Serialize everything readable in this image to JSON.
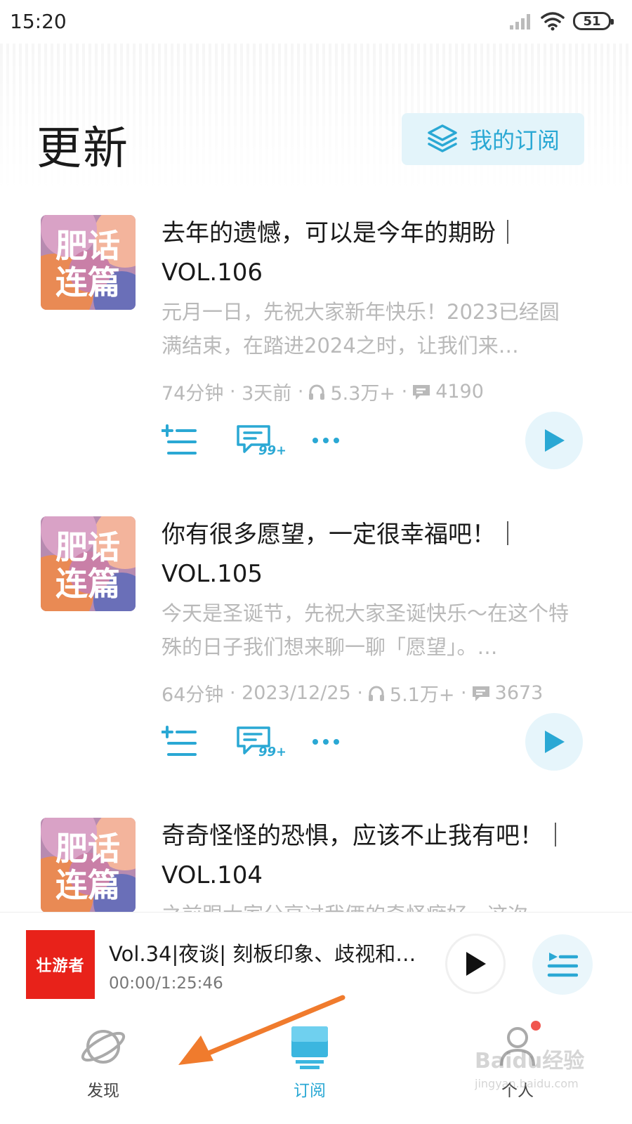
{
  "status_bar": {
    "time": "15:20",
    "battery": "51"
  },
  "header": {
    "title": "更新",
    "my_subscriptions_label": "我的订阅"
  },
  "episodes": [
    {
      "title": "去年的遗憾，可以是今年的期盼｜VOL.106",
      "description": "元月一日，先祝大家新年快乐！2023已经圆满结束，在踏进2024之时，让我们来…",
      "duration": "74分钟",
      "date": "3天前",
      "plays": "5.3万+",
      "comments": "4190",
      "comment_badge": "99+"
    },
    {
      "title": "你有很多愿望，一定很幸福吧！｜VOL.105",
      "description": "今天是圣诞节，先祝大家圣诞快乐～在这个特殊的日子我们想来聊一聊「愿望」。…",
      "duration": "64分钟",
      "date": "2023/12/25",
      "plays": "5.1万+",
      "comments": "3673",
      "comment_badge": "99+"
    },
    {
      "title": "奇奇怪怪的恐惧，应该不止我有吧！｜VOL.104",
      "description": "之前跟大家分享过我俩的奇怪癖好，这次"
    }
  ],
  "cover_art_text": [
    "肥话",
    "连篇"
  ],
  "player": {
    "title": "Vol.34|夜谈| 刻板印象、歧视和…",
    "time": "00:00/1:25:46",
    "cover_text": "壮游者"
  },
  "tabs": [
    {
      "label": "发现",
      "icon": "planet-icon"
    },
    {
      "label": "订阅",
      "icon": "subscription-icon",
      "active": true
    },
    {
      "label": "个人",
      "icon": "person-icon"
    }
  ],
  "watermark": {
    "text": "Baidu经验",
    "url": "jingyan.baidu.com"
  },
  "colors": {
    "accent": "#2aa8d4",
    "accent_bg": "#e3f4fa",
    "arrow": "#f07b2d",
    "player_cover": "#e8221a"
  }
}
